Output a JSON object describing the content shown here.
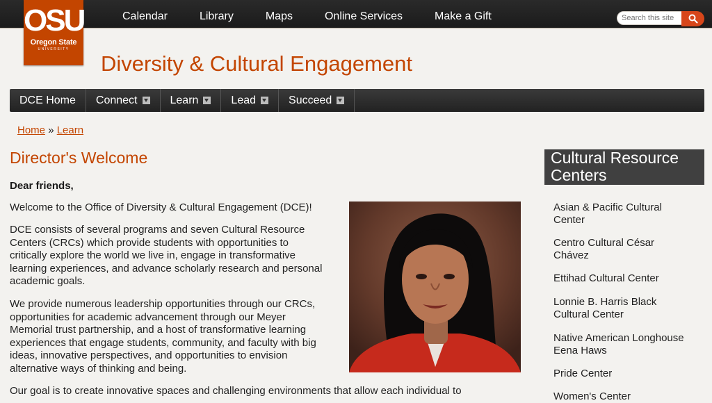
{
  "topbar": {
    "logo_main": "OSU",
    "logo_sub": "Oregon State",
    "logo_uni": "UNIVERSITY",
    "nav": [
      "Calendar",
      "Library",
      "Maps",
      "Online Services",
      "Make a Gift"
    ],
    "search_placeholder": "Search this site",
    "search_icon": "search-icon"
  },
  "site_title": "Diversity & Cultural Engagement",
  "mainnav": {
    "items": [
      {
        "label": "DCE Home",
        "dropdown": false
      },
      {
        "label": "Connect",
        "dropdown": true
      },
      {
        "label": "Learn",
        "dropdown": true
      },
      {
        "label": "Lead",
        "dropdown": true
      },
      {
        "label": "Succeed",
        "dropdown": true
      }
    ]
  },
  "breadcrumb": {
    "home": "Home",
    "sep": "»",
    "current": "Learn"
  },
  "page_title": "Director's Welcome",
  "content": {
    "greeting": "Dear friends,",
    "p1": "Welcome to the Office of Diversity & Cultural Engagement (DCE)!",
    "p2_lines": [
      "DCE consists of several programs and seven Cultural Resource",
      "Centers (CRCs) which provide students with opportunities to",
      "critically explore the world we live in, engage in transformative",
      "learning experiences, and advance scholarly research and personal",
      "academic goals."
    ],
    "p3_lines": [
      "We provide numerous leadership opportunities through our CRCs,",
      "opportunities for academic advancement through our Meyer",
      "Memorial trust partnership, and a host of transformative learning",
      "experiences that engage students, community, and faculty with big",
      "ideas, innovative perspectives, and opportunities to envision",
      "alternative ways of thinking and being."
    ],
    "p4": "Our goal is to create innovative spaces and challenging environments that allow each individual to"
  },
  "sidebar": {
    "heading_lines": [
      "Cultural Resource",
      "Centers"
    ],
    "items": [
      [
        "Asian & Pacific Cultural",
        "Center"
      ],
      [
        "Centro Cultural César",
        "Chávez"
      ],
      [
        "Ettihad Cultural Center"
      ],
      [
        "Lonnie B. Harris Black",
        "Cultural Center"
      ],
      [
        "Native American Longhouse",
        "Eena Haws"
      ],
      [
        "Pride Center"
      ],
      [
        "Women's Center"
      ]
    ]
  },
  "colors": {
    "brand": "#c34500",
    "nav_dark": "#2b2b2b",
    "search_button": "#d7461a"
  }
}
